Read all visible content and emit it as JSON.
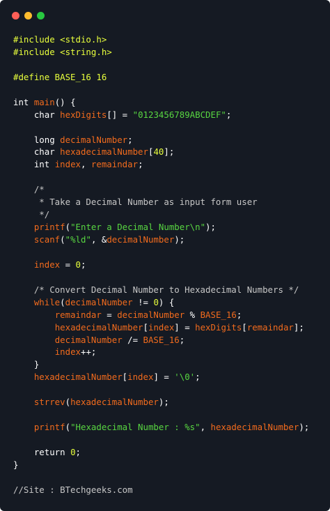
{
  "window": {
    "buttons": {
      "close_color": "#ff5f57",
      "minimize_color": "#febc2e",
      "maximize_color": "#28c840"
    },
    "background": "#151a23"
  },
  "code_lines": [
    [
      [
        "pre",
        "#include <stdio.h>"
      ]
    ],
    [
      [
        "pre",
        "#include <string.h>"
      ]
    ],
    [],
    [
      [
        "pre",
        "#define BASE_16 16"
      ]
    ],
    [],
    [
      [
        "kw",
        "int "
      ],
      [
        "fn",
        "main"
      ],
      [
        "plain",
        "() {"
      ]
    ],
    [
      [
        "plain",
        "    "
      ],
      [
        "kw",
        "char "
      ],
      [
        "var",
        "hexDigits"
      ],
      [
        "plain",
        "[] = "
      ],
      [
        "str",
        "\"0123456789ABCDEF\""
      ],
      [
        "plain",
        ";"
      ]
    ],
    [],
    [
      [
        "plain",
        "    "
      ],
      [
        "kw",
        "long "
      ],
      [
        "var",
        "decimalNumber"
      ],
      [
        "plain",
        ";"
      ]
    ],
    [
      [
        "plain",
        "    "
      ],
      [
        "kw",
        "char "
      ],
      [
        "var",
        "hexadecimalNumber"
      ],
      [
        "plain",
        "["
      ],
      [
        "num",
        "40"
      ],
      [
        "plain",
        "];"
      ]
    ],
    [
      [
        "plain",
        "    "
      ],
      [
        "kw",
        "int "
      ],
      [
        "var",
        "index"
      ],
      [
        "plain",
        ", "
      ],
      [
        "var",
        "remaindar"
      ],
      [
        "plain",
        ";"
      ]
    ],
    [],
    [
      [
        "cmt",
        "    /*"
      ]
    ],
    [
      [
        "cmt",
        "     * Take a Decimal Number as input form user"
      ]
    ],
    [
      [
        "cmt",
        "     */"
      ]
    ],
    [
      [
        "plain",
        "    "
      ],
      [
        "fn",
        "printf"
      ],
      [
        "plain",
        "("
      ],
      [
        "str",
        "\"Enter a Decimal Number\\n\""
      ],
      [
        "plain",
        ");"
      ]
    ],
    [
      [
        "plain",
        "    "
      ],
      [
        "fn",
        "scanf"
      ],
      [
        "plain",
        "("
      ],
      [
        "str",
        "\"%ld\""
      ],
      [
        "plain",
        ", &"
      ],
      [
        "var",
        "decimalNumber"
      ],
      [
        "plain",
        ");"
      ]
    ],
    [],
    [
      [
        "plain",
        "    "
      ],
      [
        "var",
        "index"
      ],
      [
        "plain",
        " = "
      ],
      [
        "num",
        "0"
      ],
      [
        "plain",
        ";"
      ]
    ],
    [],
    [
      [
        "cmt",
        "    /* Convert Decimal Number to Hexadecimal Numbers */"
      ]
    ],
    [
      [
        "plain",
        "    "
      ],
      [
        "fn",
        "while"
      ],
      [
        "plain",
        "("
      ],
      [
        "var",
        "decimalNumber"
      ],
      [
        "plain",
        " != "
      ],
      [
        "num",
        "0"
      ],
      [
        "plain",
        ") {"
      ]
    ],
    [
      [
        "plain",
        "        "
      ],
      [
        "var",
        "remaindar"
      ],
      [
        "plain",
        " = "
      ],
      [
        "var",
        "decimalNumber"
      ],
      [
        "plain",
        " % "
      ],
      [
        "var",
        "BASE_16"
      ],
      [
        "plain",
        ";"
      ]
    ],
    [
      [
        "plain",
        "        "
      ],
      [
        "var",
        "hexadecimalNumber"
      ],
      [
        "plain",
        "["
      ],
      [
        "var",
        "index"
      ],
      [
        "plain",
        "] = "
      ],
      [
        "var",
        "hexDigits"
      ],
      [
        "plain",
        "["
      ],
      [
        "var",
        "remaindar"
      ],
      [
        "plain",
        "];"
      ]
    ],
    [
      [
        "plain",
        "        "
      ],
      [
        "var",
        "decimalNumber"
      ],
      [
        "plain",
        " /= "
      ],
      [
        "var",
        "BASE_16"
      ],
      [
        "plain",
        ";"
      ]
    ],
    [
      [
        "plain",
        "        "
      ],
      [
        "var",
        "index"
      ],
      [
        "plain",
        "++;"
      ]
    ],
    [
      [
        "plain",
        "    }"
      ]
    ],
    [
      [
        "plain",
        "    "
      ],
      [
        "var",
        "hexadecimalNumber"
      ],
      [
        "plain",
        "["
      ],
      [
        "var",
        "index"
      ],
      [
        "plain",
        "] = "
      ],
      [
        "str",
        "'\\0'"
      ],
      [
        "plain",
        ";"
      ]
    ],
    [],
    [
      [
        "plain",
        "    "
      ],
      [
        "fn",
        "strrev"
      ],
      [
        "plain",
        "("
      ],
      [
        "var",
        "hexadecimalNumber"
      ],
      [
        "plain",
        ");"
      ]
    ],
    [],
    [
      [
        "plain",
        "    "
      ],
      [
        "fn",
        "printf"
      ],
      [
        "plain",
        "("
      ],
      [
        "str",
        "\"Hexadecimal Number : %s\""
      ],
      [
        "plain",
        ", "
      ],
      [
        "var",
        "hexadecimalNumber"
      ],
      [
        "plain",
        ");"
      ]
    ],
    [],
    [
      [
        "plain",
        "    "
      ],
      [
        "kw",
        "return "
      ],
      [
        "num",
        "0"
      ],
      [
        "plain",
        ";"
      ]
    ],
    [
      [
        "plain",
        "}"
      ]
    ],
    [],
    [
      [
        "cmt",
        "//Site : BTechgeeks.com"
      ]
    ]
  ]
}
